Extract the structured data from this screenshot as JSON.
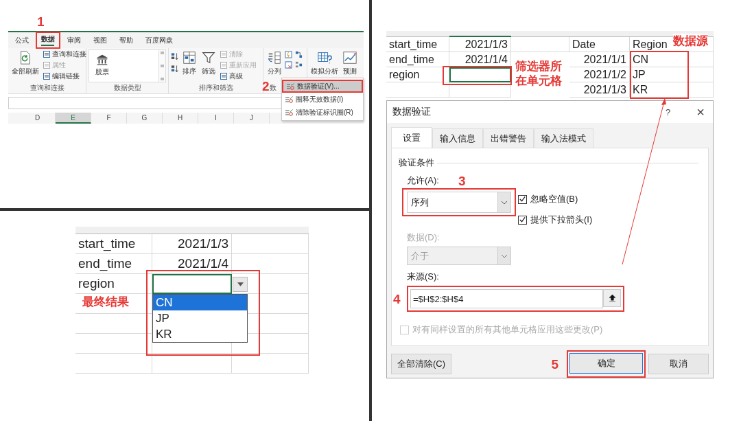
{
  "ribbon": {
    "step": "1",
    "tabs": [
      {
        "label": "公式",
        "selected": false
      },
      {
        "label": "数据",
        "selected": true
      },
      {
        "label": "审阅",
        "selected": false
      },
      {
        "label": "视图",
        "selected": false
      },
      {
        "label": "帮助",
        "selected": false
      },
      {
        "label": "百度网盘",
        "selected": false
      }
    ],
    "groups": [
      {
        "kind": "query",
        "label": "查询和连接",
        "buttons": [
          {
            "label": "全部刷新"
          }
        ],
        "smalls": [
          {
            "label": "查询和连接",
            "disabled": false
          },
          {
            "label": "属性",
            "disabled": true
          },
          {
            "label": "编辑链接",
            "disabled": false
          }
        ]
      },
      {
        "kind": "types",
        "label": "数据类型",
        "gallery": "股票"
      },
      {
        "kind": "sort",
        "label": "排序和筛选",
        "buttons": [
          {
            "label": "排序"
          },
          {
            "label": "筛选"
          }
        ],
        "smalls": [
          {
            "label": "清除",
            "disabled": true
          },
          {
            "label": "重新应用",
            "disabled": true
          },
          {
            "label": "高级",
            "disabled": false
          }
        ]
      },
      {
        "kind": "tools",
        "label": "数",
        "buttons": [
          {
            "label": "分列"
          }
        ]
      },
      {
        "kind": "analysis",
        "buttons": [
          {
            "label": "模拟分析"
          },
          {
            "label": "预测"
          }
        ]
      }
    ],
    "menu": {
      "step": "2",
      "items": [
        {
          "label": "数据验证(V)...",
          "selected": true
        },
        {
          "label": "圈释无效数据(I)",
          "selected": false
        },
        {
          "label": "清除验证标识圈(R)",
          "selected": false
        }
      ]
    },
    "columns": [
      {
        "label": "D",
        "selected": false
      },
      {
        "label": "E",
        "selected": true
      },
      {
        "label": "F",
        "selected": false
      },
      {
        "label": "G",
        "selected": false
      },
      {
        "label": "H",
        "selected": false
      },
      {
        "label": "I",
        "selected": false
      },
      {
        "label": "J",
        "selected": false
      }
    ]
  },
  "source_sheet": {
    "filter_cell_note": "筛选器所在单元格",
    "source_note": "数据源",
    "rows": [
      {
        "cells": [
          {
            "kind": "text",
            "text": "start_time"
          },
          {
            "kind": "number",
            "text": "2021/1/3"
          },
          {
            "kind": "empty"
          },
          {
            "kind": "text",
            "text": "Date"
          },
          {
            "kind": "text",
            "text": "Region"
          }
        ]
      },
      {
        "cells": [
          {
            "kind": "text",
            "text": "end_time"
          },
          {
            "kind": "number",
            "text": "2021/1/4"
          },
          {
            "kind": "empty"
          },
          {
            "kind": "number",
            "text": "2021/1/1"
          },
          {
            "kind": "text",
            "text": "CN"
          }
        ]
      },
      {
        "cells": [
          {
            "kind": "text",
            "text": "region"
          },
          {
            "kind": "active"
          },
          {
            "kind": "empty"
          },
          {
            "kind": "number",
            "text": "2021/1/2"
          },
          {
            "kind": "text",
            "text": "JP"
          }
        ]
      },
      {
        "cells": [
          {
            "kind": "empty"
          },
          {
            "kind": "empty"
          },
          {
            "kind": "empty"
          },
          {
            "kind": "number",
            "text": "2021/1/3"
          },
          {
            "kind": "text",
            "text": "KR"
          }
        ]
      }
    ]
  },
  "dialog": {
    "title": "数据验证",
    "help": "?",
    "close": "×",
    "tabs": [
      {
        "label": "设置",
        "selected": true
      },
      {
        "label": "输入信息",
        "selected": false
      },
      {
        "label": "出错警告",
        "selected": false
      },
      {
        "label": "输入法模式",
        "selected": false
      }
    ],
    "section": "验证条件",
    "allow": {
      "label": "允许(A):",
      "step": "3",
      "value": "序列"
    },
    "checkboxes": [
      {
        "label": "忽略空值(B)",
        "checked": true
      },
      {
        "label": "提供下拉箭头(I)",
        "checked": true
      }
    ],
    "data": {
      "label": "数据(D):",
      "value": "介于",
      "disabled": true
    },
    "source": {
      "label": "来源(S):",
      "step": "4",
      "value": "=$H$2:$H$4"
    },
    "apply_all": {
      "label": "对有同样设置的所有其他单元格应用这些更改(P)",
      "checked": false,
      "disabled": true
    },
    "confirm_step": "5",
    "buttons": [
      {
        "label": "全部清除(C)",
        "default": false
      },
      {
        "label": "确定",
        "default": true
      },
      {
        "label": "取消",
        "default": false
      }
    ]
  },
  "result_sheet": {
    "note": "最终结果",
    "rows": [
      {
        "cells": [
          {
            "kind": "text",
            "text": "start_time"
          },
          {
            "kind": "number",
            "text": "2021/1/3"
          },
          {
            "kind": "empty"
          }
        ]
      },
      {
        "cells": [
          {
            "kind": "text",
            "text": "end_time"
          },
          {
            "kind": "number",
            "text": "2021/1/4"
          },
          {
            "kind": "empty"
          }
        ]
      },
      {
        "cells": [
          {
            "kind": "text",
            "text": "region"
          },
          {
            "kind": "active"
          },
          {
            "kind": "empty"
          }
        ]
      }
    ],
    "dropdown": {
      "items": [
        {
          "label": "CN",
          "selected": true
        },
        {
          "label": "JP",
          "selected": false
        },
        {
          "label": "KR",
          "selected": false
        }
      ]
    }
  }
}
